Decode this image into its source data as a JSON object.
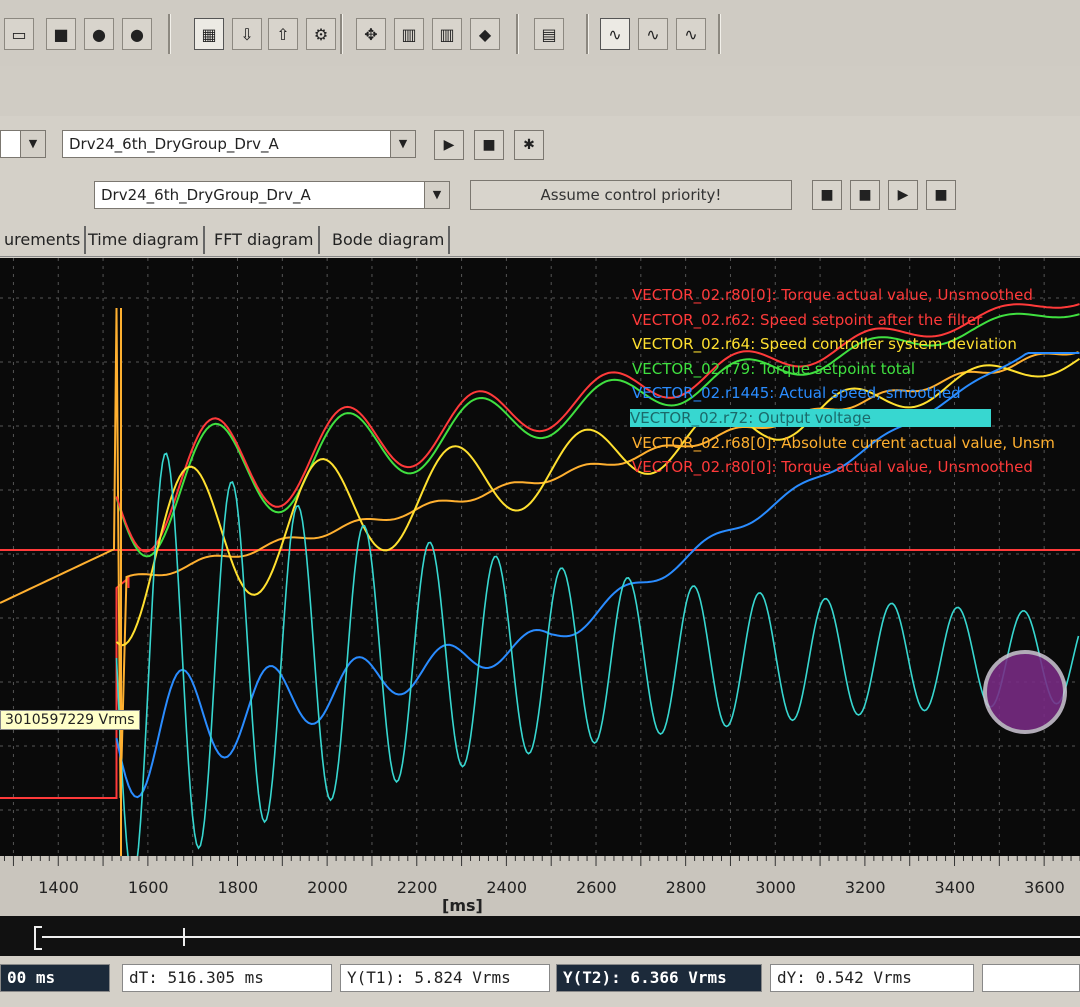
{
  "toolbar": {
    "icons": [
      "open-icon",
      "step-icon",
      "stop-icon",
      "circle-icon",
      "circle-icon",
      "trigger-icon",
      "download-icon",
      "upload-icon",
      "settings-icon",
      "cursor-icon",
      "measure-icon",
      "measure-icon",
      "record-icon",
      "zoom-icon",
      "scope-icon",
      "scope-icon",
      "scope-icon"
    ]
  },
  "row3": {
    "drive_select": "Drv24_6th_DryGroup_Drv_A"
  },
  "row4": {
    "drive_select": "Drv24_6th_DryGroup_Drv_A",
    "priority_button": "Assume control priority!"
  },
  "tabs": [
    {
      "label": "urements"
    },
    {
      "label": "Time diagram"
    },
    {
      "label": "FFT diagram"
    },
    {
      "label": "Bode diagram"
    }
  ],
  "legend": [
    {
      "text": "VECTOR_02.r80[0]: Torque actual value, Unsmoothed",
      "color": "#ff3a3a"
    },
    {
      "text": "VECTOR_02.r62: Speed setpoint after the filter",
      "color": "#ff3a3a"
    },
    {
      "text": "VECTOR_02.r64: Speed controller system deviation",
      "color": "#ffe030"
    },
    {
      "text": "VECTOR_02.r79: Torque setpoint total",
      "color": "#40e040"
    },
    {
      "text": "VECTOR_02.r1445: Actual speed, smoothed",
      "color": "#2a8cff"
    },
    {
      "text": "VECTOR_02.r72: Output voltage",
      "color": "#1a6a6a",
      "bg": "#37d7d0"
    },
    {
      "text": "VECTOR_02.r68[0]: Absolute current actual value, Unsm",
      "color": "#ffb030"
    },
    {
      "text": "VECTOR_02.r80[0]: Torque actual value, Unsmoothed",
      "color": "#ff3a3a"
    }
  ],
  "cursor_label": "3010597229 Vrms",
  "chart_data": {
    "type": "line",
    "xlabel": "[ms]",
    "x_ticks": [
      1400,
      1600,
      1800,
      2000,
      2200,
      2400,
      2600,
      2800,
      3000,
      3200,
      3400,
      3600
    ],
    "xlim": [
      1270,
      3680
    ],
    "grid": true
  },
  "status": {
    "t": "00 ms",
    "dT": "dT: 516.305 ms",
    "yT1": "Y(T1):  5.824 Vrms",
    "yT2": "Y(T2): 6.366 Vrms",
    "dY": "dY: 0.542 Vrms"
  }
}
